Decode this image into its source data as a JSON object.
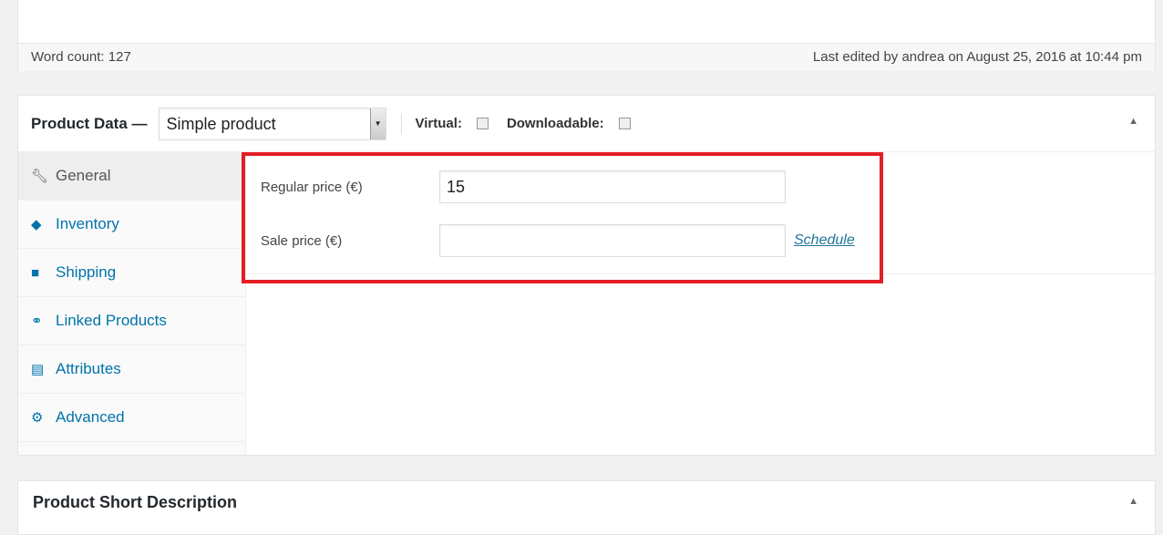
{
  "editor": {
    "word_count": "Word count: 127",
    "last_edited": "Last edited by andrea on August 25, 2016 at 10:44 pm"
  },
  "product_data": {
    "title": "Product Data —",
    "type_select": "Simple product",
    "virtual_label": "Virtual:",
    "downloadable_label": "Downloadable:",
    "tabs": [
      {
        "label": "General",
        "icon": "wrench-icon"
      },
      {
        "label": "Inventory",
        "icon": "tag-icon"
      },
      {
        "label": "Shipping",
        "icon": "truck-icon"
      },
      {
        "label": "Linked Products",
        "icon": "link-icon"
      },
      {
        "label": "Attributes",
        "icon": "list-icon"
      },
      {
        "label": "Advanced",
        "icon": "gear-icon"
      }
    ],
    "regular_price_label": "Regular price (€)",
    "regular_price_value": "15",
    "sale_price_label": "Sale price (€)",
    "sale_price_value": "",
    "schedule_link": "Schedule"
  },
  "short_description": {
    "title": "Product Short Description"
  },
  "highlight_color": "#e31e24"
}
